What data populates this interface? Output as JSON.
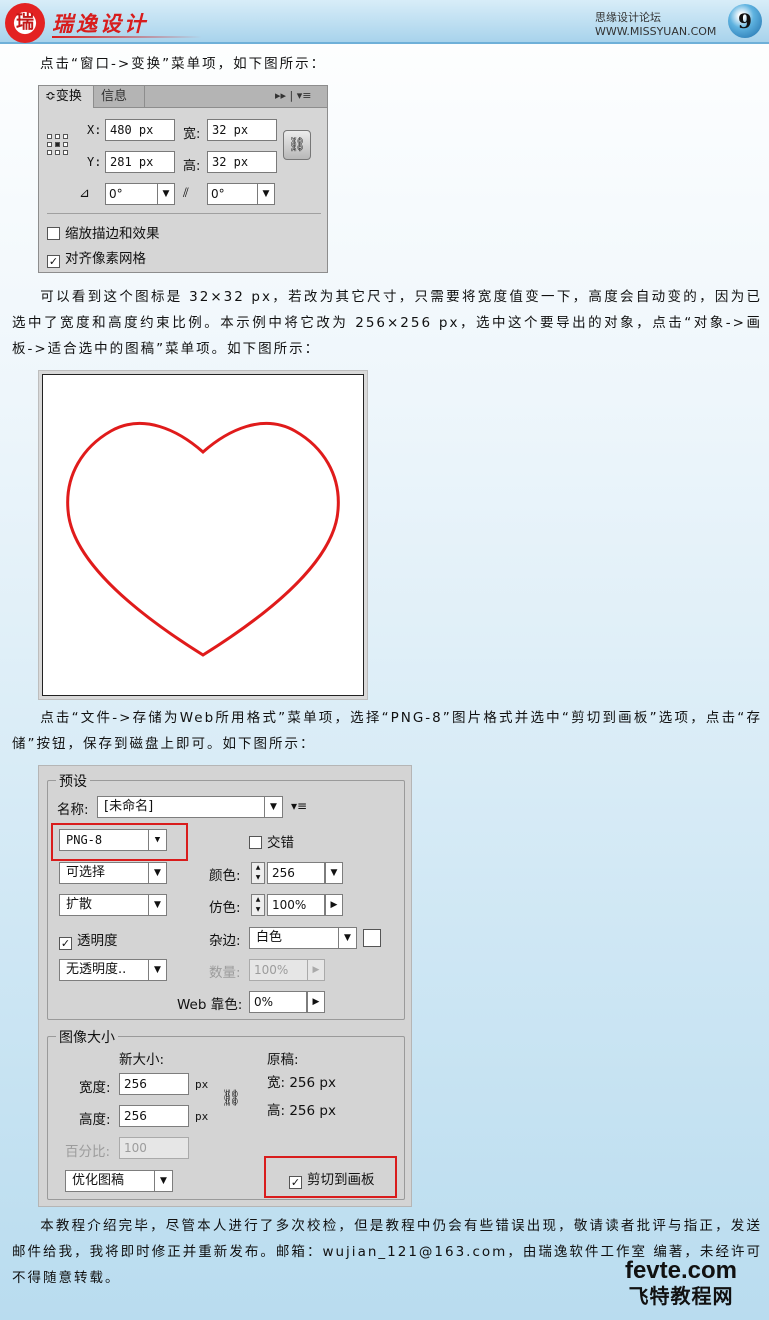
{
  "header": {
    "logo_text": "瑞",
    "brand": "瑞逸设计",
    "site": "思缘设计论坛 WWW.MISSYUAN.COM",
    "page_number": "9"
  },
  "paragraphs": {
    "p1": "点击“窗口->变换”菜单项，如下图所示：",
    "p2": "可以看到这个图标是 32×32 px，若改为其它尺寸，只需要将宽度值变一下，高度会自动变的，因为已选中了宽度和高度约束比例。本示例中将它改为 256×256 px，选中这个要导出的对象，点击“对象->画板->适合选中的图稿”菜单项。如下图所示：",
    "p3": "点击“文件->存储为Web所用格式”菜单项，选择“PNG-8”图片格式并选中“剪切到画板”选项，点击“存储”按钮，保存到磁盘上即可。如下图所示：",
    "p4": "本教程介绍完毕，尽管本人进行了多次校检，但是教程中仍会有些错误出现，敬请读者批评与指正，发送邮件给我，我将即时修正并重新发布。邮箱：wujian_121@163.com，由瑞逸软件工作室 编著，未经许可不得随意转载。"
  },
  "transform_panel": {
    "tab_active": "≎变换",
    "tab_second": "信息",
    "tab_controls": "▸▸ | ▾≡",
    "x_label": "X:",
    "x_value": "480 px",
    "y_label": "Y:",
    "y_value": "281 px",
    "w_label": "宽:",
    "w_value": "32 px",
    "h_label": "高:",
    "h_value": "32 px",
    "rotate_value": "0°",
    "shear_value": "0°",
    "check_scale": "缩放描边和效果",
    "check_align": "对齐像素网格",
    "scale_checked": false,
    "align_checked": true
  },
  "save_panel": {
    "preset_title": "预设",
    "name_label": "名称:",
    "name_value": "[未命名]",
    "format_value": "PNG-8",
    "interlace_label": "交错",
    "selective_value": "可选择",
    "colors_label": "颜色:",
    "colors_value": "256",
    "diffusion_value": "扩散",
    "dither_label": "仿色:",
    "dither_value": "100%",
    "transparency_label": "透明度",
    "matte_label": "杂边:",
    "matte_value": "白色",
    "no_transparency_value": "无透明度..",
    "amount_label": "数量:",
    "amount_value": "100%",
    "websnap_label": "Web 靠色:",
    "websnap_value": "0%",
    "image_size_title": "图像大小",
    "new_size_label": "新大小:",
    "width_label": "宽度:",
    "width_value": "256",
    "height_label": "高度:",
    "height_value": "256",
    "unit_px": "px",
    "original_label": "原稿:",
    "orig_w": "宽: 256 px",
    "orig_h": "高: 256 px",
    "percent_label": "百分比:",
    "percent_value": "100",
    "optimize_value": "优化图稿",
    "clip_label": "剪切到画板",
    "clip_checked": true,
    "transparency_checked": true
  },
  "watermark": {
    "line1": "fevte.com",
    "line2": "飞特教程网"
  },
  "colors": {
    "heart_stroke": "#e01b1b",
    "highlight": "#d91c1c"
  }
}
